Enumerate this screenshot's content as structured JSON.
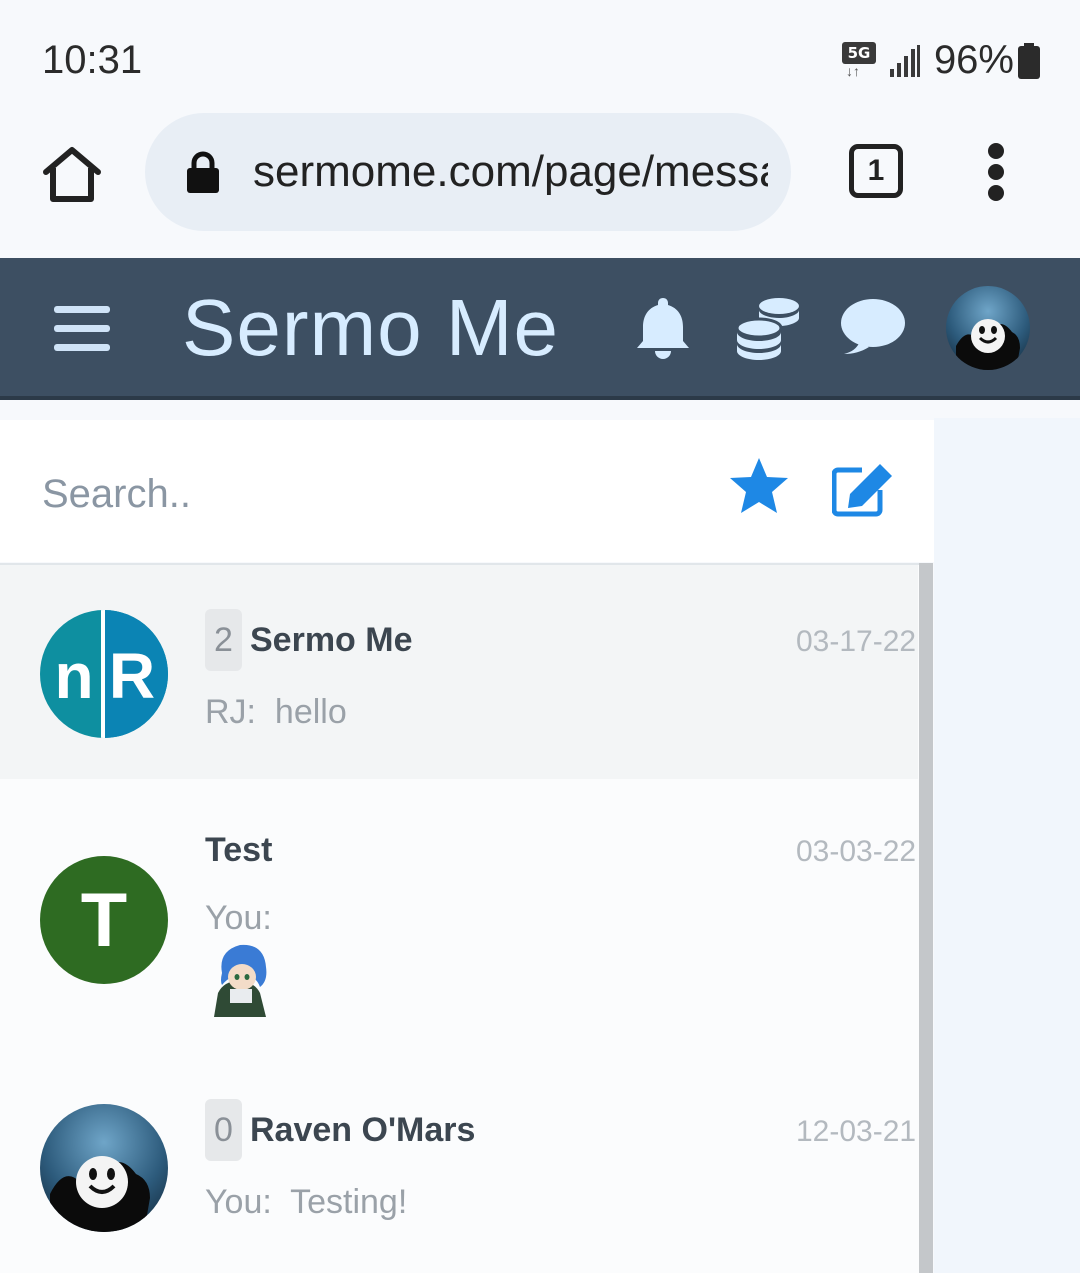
{
  "status_bar": {
    "time": "10:31",
    "network": "5G",
    "battery": "96%"
  },
  "browser": {
    "url": "sermome.com/page/messages",
    "tab_count": "1",
    "icons": [
      "home-icon",
      "lock-icon",
      "tabs-icon",
      "more-vert-icon"
    ]
  },
  "app": {
    "title": "Sermo Me",
    "header_icons": [
      "menu-icon",
      "bell-icon",
      "coins-icon",
      "chat-bubble-icon",
      "avatar"
    ],
    "header_color": "#3d4f62",
    "accent_color": "#1e88e5"
  },
  "search": {
    "placeholder": "Search.."
  },
  "conversations": [
    {
      "avatar_letters": [
        "n",
        "R"
      ],
      "avatar_color": "#0e8fa0",
      "unread": "2",
      "name": "Sermo Me",
      "date": "03-17-22",
      "sender": "RJ:",
      "message": "hello"
    },
    {
      "avatar_letters": [
        "T"
      ],
      "avatar_color": "#2e6b22",
      "name": "Test",
      "date": "03-03-22",
      "sender": "You:",
      "message": ""
    },
    {
      "avatar_letters": [],
      "unread": "0",
      "name": "Raven O'Mars",
      "date": "12-03-21",
      "sender": "You:",
      "message": "Testing!"
    }
  ]
}
